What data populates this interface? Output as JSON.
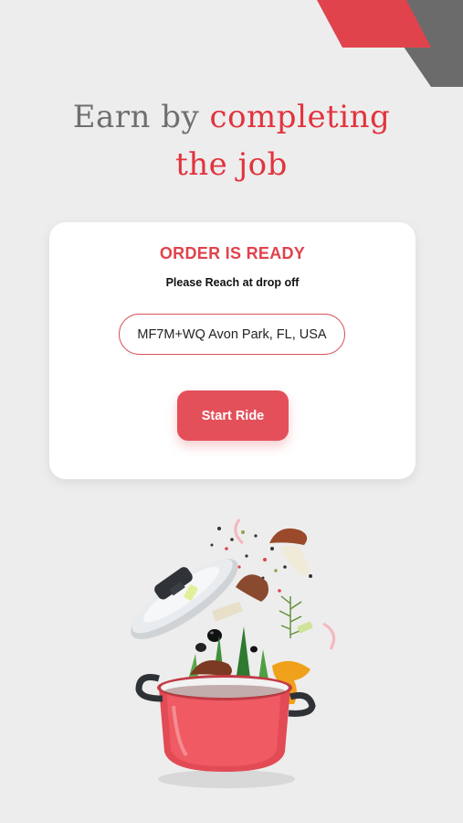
{
  "headline": {
    "part_plain": "Earn by ",
    "part_accent_1": "completing",
    "part_accent_2": "the job"
  },
  "card": {
    "title": "ORDER IS READY",
    "subtitle": "Please Reach at drop off",
    "address_value": "MF7M+WQ Avon Park, FL, USA",
    "start_button_label": "Start Ride"
  },
  "colors": {
    "background": "#ededed",
    "accent_red": "#e2333d",
    "button_red": "#e4505a",
    "headline_gray": "#6f6f6f",
    "corner_gray": "#6b6b6b"
  },
  "icons": {
    "corner": "corner-stripes",
    "illustration": "cooking-pot-with-vegetables"
  }
}
